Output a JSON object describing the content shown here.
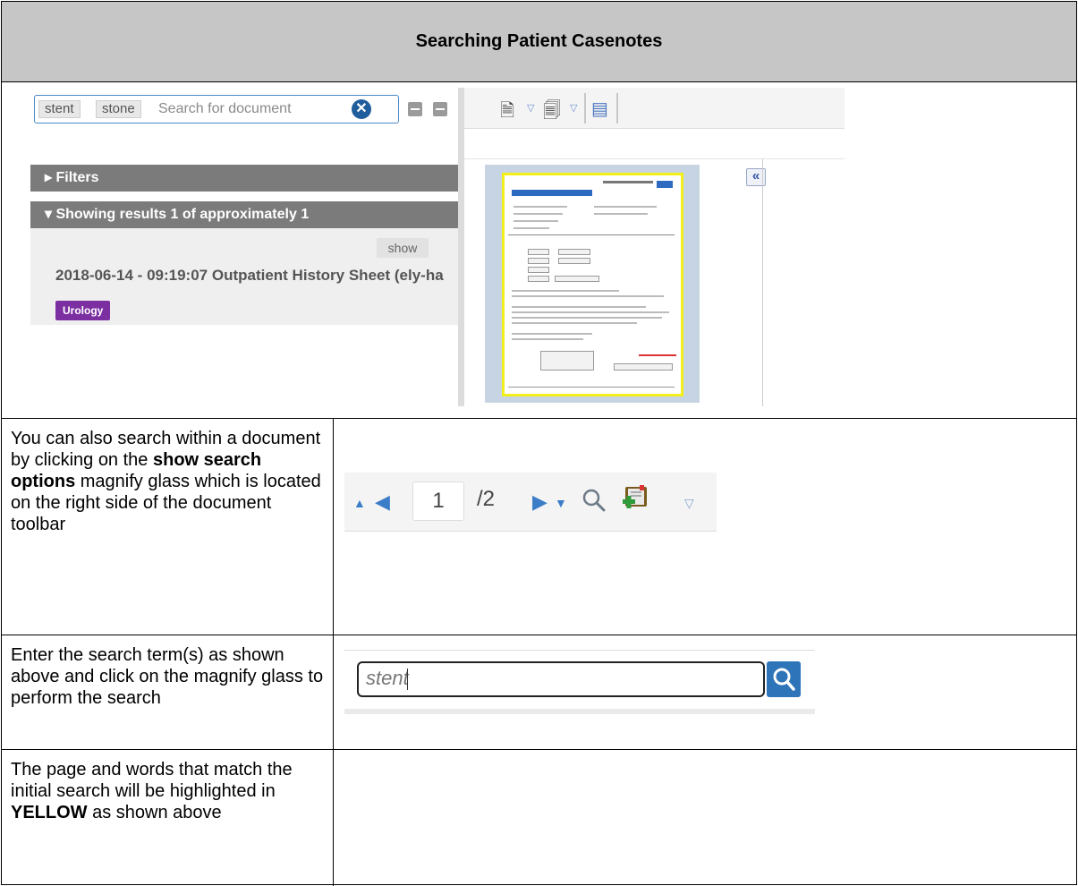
{
  "header": {
    "title": "Searching Patient Casenotes"
  },
  "casenotes_search": {
    "tags": [
      "stent",
      "stone"
    ],
    "placeholder": "Search for document",
    "filters_label": "Filters",
    "results_label": "Showing results 1 of approximately 1",
    "show_label": "show",
    "result_title": "2018-06-14 - 09:19:07 Outpatient History Sheet (ely-ha",
    "specialty": "Urology",
    "specialty_color": "#7b2fa1"
  },
  "steps": {
    "search_within": {
      "pre": "You can also search within a document by clicking on the ",
      "bold": "show search options",
      "post": " magnify glass which is located on the right side of the document toolbar"
    },
    "enter_terms": {
      "text": "Enter the search term(s) as shown above and click on the magnify glass to perform the search"
    },
    "highlight": {
      "pre": "The page and words that match the initial search will be highlighted in ",
      "bold": "YELLOW",
      "post": " as shown above"
    }
  },
  "doc_toolbar": {
    "current_page": "1",
    "total_pages": "/2"
  },
  "doc_search": {
    "value": "stent"
  },
  "colors": {
    "highlight": "#f2ef1a",
    "accent": "#2e74b8"
  }
}
